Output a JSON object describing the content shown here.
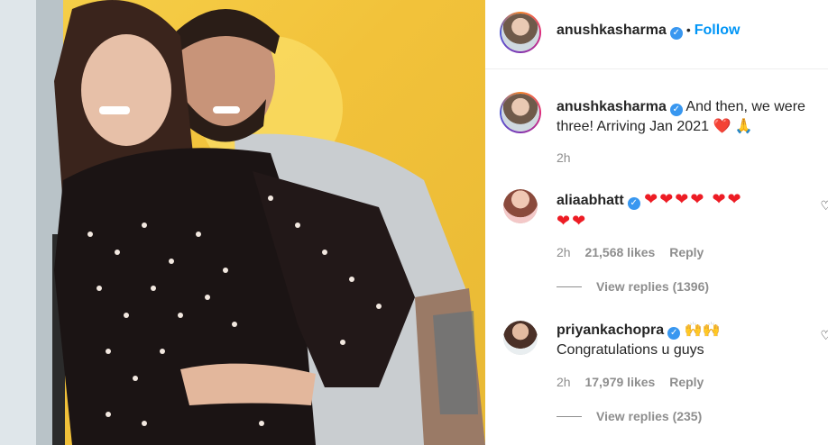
{
  "header": {
    "username": "anushkasharma",
    "follow_label": "Follow",
    "separator": "•"
  },
  "caption": {
    "username": "anushkasharma",
    "text": "And then, we were three! Arriving Jan 2021",
    "emoji": "❤️ 🙏",
    "time": "2h"
  },
  "comments": [
    {
      "username": "aliaabhatt",
      "hearts_line1": "❤❤❤❤ ❤❤",
      "hearts_line2": "❤❤",
      "time": "2h",
      "likes": "21,568 likes",
      "reply_label": "Reply",
      "view_replies": "View replies (1396)"
    },
    {
      "username": "priyankachopra",
      "emoji": "🙌🙌",
      "text": "Congratulations u guys",
      "time": "2h",
      "likes": "17,979 likes",
      "reply_label": "Reply",
      "view_replies": "View replies (235)"
    }
  ],
  "icons": {
    "verified": "verified-badge-icon",
    "like": "heart-outline-icon"
  },
  "colors": {
    "follow": "#0095f6",
    "verified": "#3897f0",
    "heart": "#ed1c24",
    "muted": "#8e8e8e"
  }
}
